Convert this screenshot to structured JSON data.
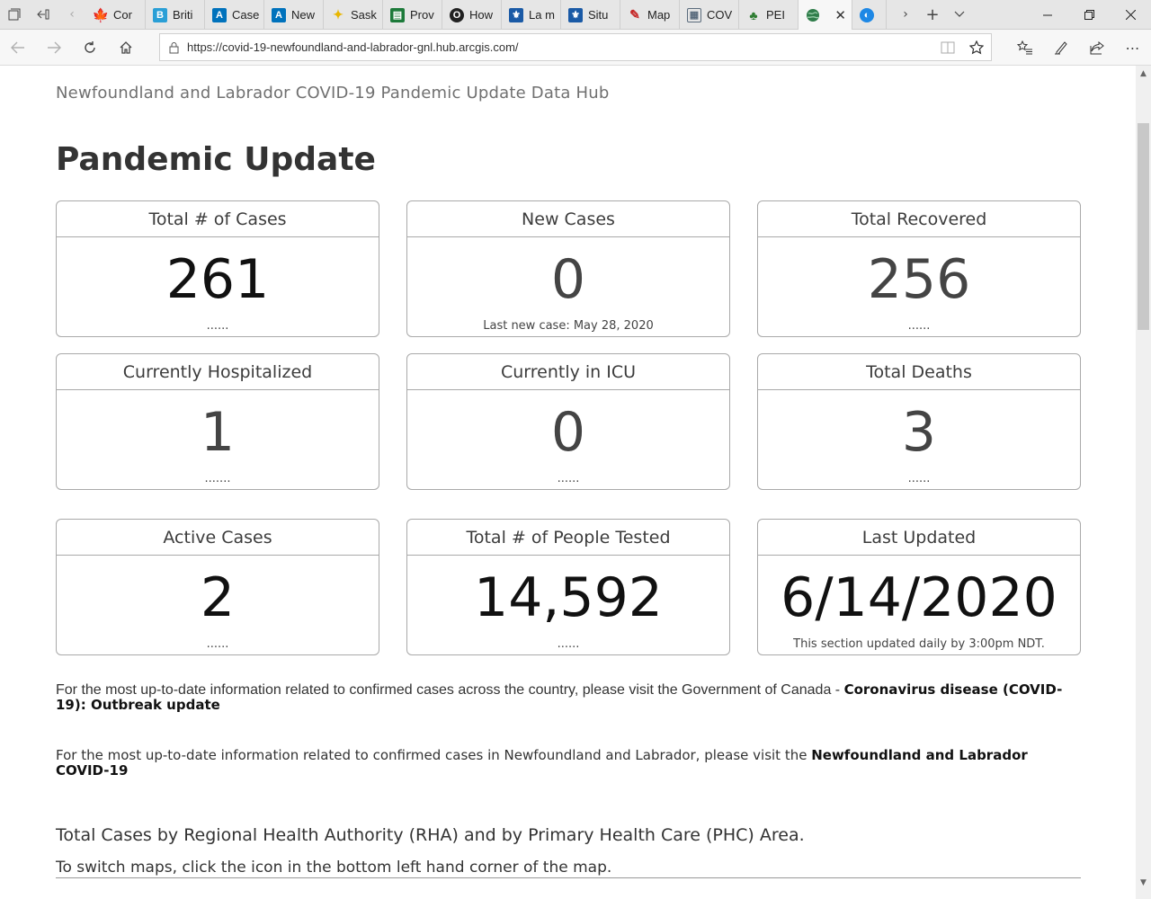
{
  "browser": {
    "tabs": [
      {
        "label": "Cor",
        "icon": "maple-leaf-icon",
        "color": "#d52b1e"
      },
      {
        "label": "Briti",
        "icon": "bc-icon",
        "color": "#2a9fd6"
      },
      {
        "label": "Case",
        "icon": "alberta-icon",
        "color": "#0072bc"
      },
      {
        "label": "New",
        "icon": "alberta-icon",
        "color": "#0072bc"
      },
      {
        "label": "Sask",
        "icon": "saskatchewan-icon",
        "color": "#e8b600"
      },
      {
        "label": "Prov",
        "icon": "manitoba-icon",
        "color": "#1d7a3a"
      },
      {
        "label": "How",
        "icon": "ontario-icon",
        "color": "#222222"
      },
      {
        "label": "La m",
        "icon": "quebec-icon",
        "color": "#1a5aa6"
      },
      {
        "label": "Situ",
        "icon": "quebec-icon",
        "color": "#1a5aa6"
      },
      {
        "label": "Map",
        "icon": "nb-icon",
        "color": "#c62828"
      },
      {
        "label": "COV",
        "icon": "ns-icon",
        "color": "#5a6b7c"
      },
      {
        "label": "PEI",
        "icon": "pei-icon",
        "color": "#2e7d32"
      }
    ],
    "active_tab_icon": "globe-icon",
    "url": "https://covid-19-newfoundland-and-labrador-gnl.hub.arcgis.com/"
  },
  "page": {
    "site_title": "Newfoundland and Labrador COVID-19 Pandemic Update Data Hub",
    "heading": "Pandemic Update",
    "cards": [
      {
        "title": "Total # of Cases",
        "value": "261",
        "foot": "......"
      },
      {
        "title": "New Cases",
        "value": "0",
        "foot": "Last new case: May 28, 2020"
      },
      {
        "title": "Total Recovered",
        "value": "256",
        "foot": "......"
      },
      {
        "title": "Currently Hospitalized",
        "value": "1",
        "foot": "......."
      },
      {
        "title": "Currently in ICU",
        "value": "0",
        "foot": "......"
      },
      {
        "title": "Total Deaths",
        "value": "3",
        "foot": "......"
      },
      {
        "title": "Active Cases",
        "value": "2",
        "foot": "......"
      },
      {
        "title": "Total # of People Tested",
        "value": "14,592",
        "foot": "......"
      },
      {
        "title": "Last Updated",
        "value": "6/14/2020",
        "foot": "This section updated daily by 3:00pm NDT."
      }
    ],
    "para1_text": "For the most up-to-date information related to confirmed cases across the country, please visit the Government of Canada - ",
    "para1_link": "Coronavirus disease (COVID-19): Outbreak update",
    "para2_text": "For the most up-to-date information related to confirmed cases in Newfoundland and Labrador, please visit the ",
    "para2_link": "Newfoundland and Labrador COVID-19",
    "section_heading": "Total Cases by Regional Health Authority (RHA) and by Primary Health Care (PHC) Area.",
    "section_sub": "To switch maps, click the icon in the bottom left hand corner of the map."
  }
}
